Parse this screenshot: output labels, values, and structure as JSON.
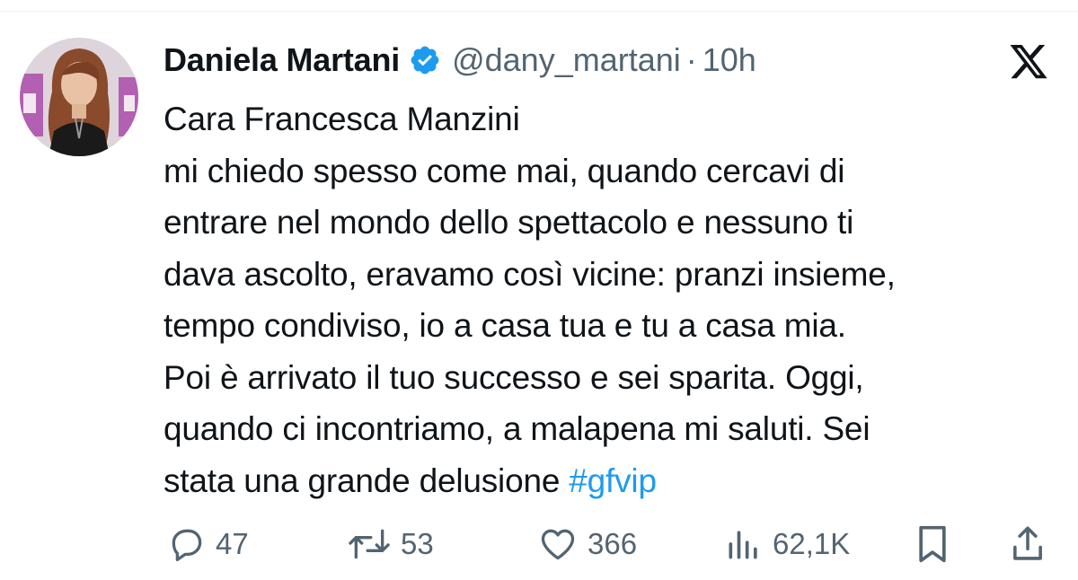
{
  "author": {
    "display_name": "Daniela Martani",
    "handle": "@dany_martani",
    "separator": "·",
    "timestamp": "10h"
  },
  "tweet": {
    "body": "Cara Francesca Manzini\nmi chiedo spesso come mai, quando cercavi di\nentrare nel mondo dello spettacolo e nessuno ti\ndava ascolto, eravamo così vicine: pranzi insieme,\ntempo condiviso, io a casa tua e tu a casa mia.\nPoi è arrivato il tuo successo e sei sparita. Oggi,\nquando ci incontriamo, a malapena mi saluti. Sei\nstata una grande delusione ",
    "hashtag": "#gfvip"
  },
  "actions": {
    "replies": "47",
    "reposts": "53",
    "likes": "366",
    "views": "62,1K"
  },
  "icons": {
    "verified": "verified-badge-icon",
    "brand": "x-logo-icon",
    "reply": "reply-icon",
    "repost": "repost-icon",
    "like": "heart-icon",
    "views": "views-chart-icon",
    "bookmark": "bookmark-icon",
    "share": "share-icon"
  },
  "colors": {
    "text": "#0f1419",
    "secondary": "#536471",
    "link": "#1d9bf0",
    "verified": "#1d9bf0"
  }
}
